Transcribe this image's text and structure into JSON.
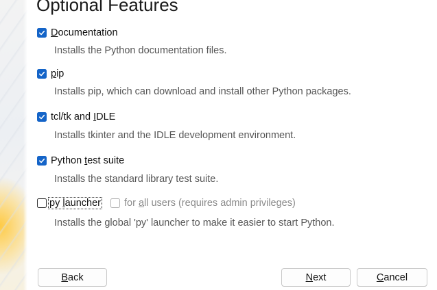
{
  "page": {
    "title": "Optional Features"
  },
  "options": [
    {
      "label_accel": "D",
      "label_rest": "ocumentation",
      "checked": true,
      "description": "Installs the Python documentation files."
    },
    {
      "label_accel": "p",
      "label_rest": "ip",
      "checked": true,
      "description": "Installs pip, which can download and install other Python packages."
    },
    {
      "label_before": "tcl/tk and ",
      "label_accel": "I",
      "label_rest": "DLE",
      "checked": true,
      "description": "Installs tkinter and the IDLE development environment."
    },
    {
      "label_before": "Python ",
      "label_accel": "t",
      "label_rest": "est suite",
      "checked": true,
      "description": "Installs the standard library test suite."
    },
    {
      "label_before": "py ",
      "label_accel": "l",
      "label_rest": "auncher",
      "checked": false,
      "description": "Installs the global 'py' launcher to make it easier to start Python.",
      "sub_option": {
        "label_before": "for ",
        "label_accel": "a",
        "label_rest": "ll users (requires admin privileges)",
        "checked": false,
        "enabled": false
      }
    }
  ],
  "buttons": {
    "back": {
      "accel": "B",
      "rest": "ack"
    },
    "next": {
      "accel": "N",
      "rest": "ext"
    },
    "cancel": {
      "accel": "C",
      "rest": "ancel"
    }
  },
  "colors": {
    "checkbox_checked": "#1464c8",
    "description_text": "#555555",
    "disabled_text": "#8a8a8a"
  }
}
